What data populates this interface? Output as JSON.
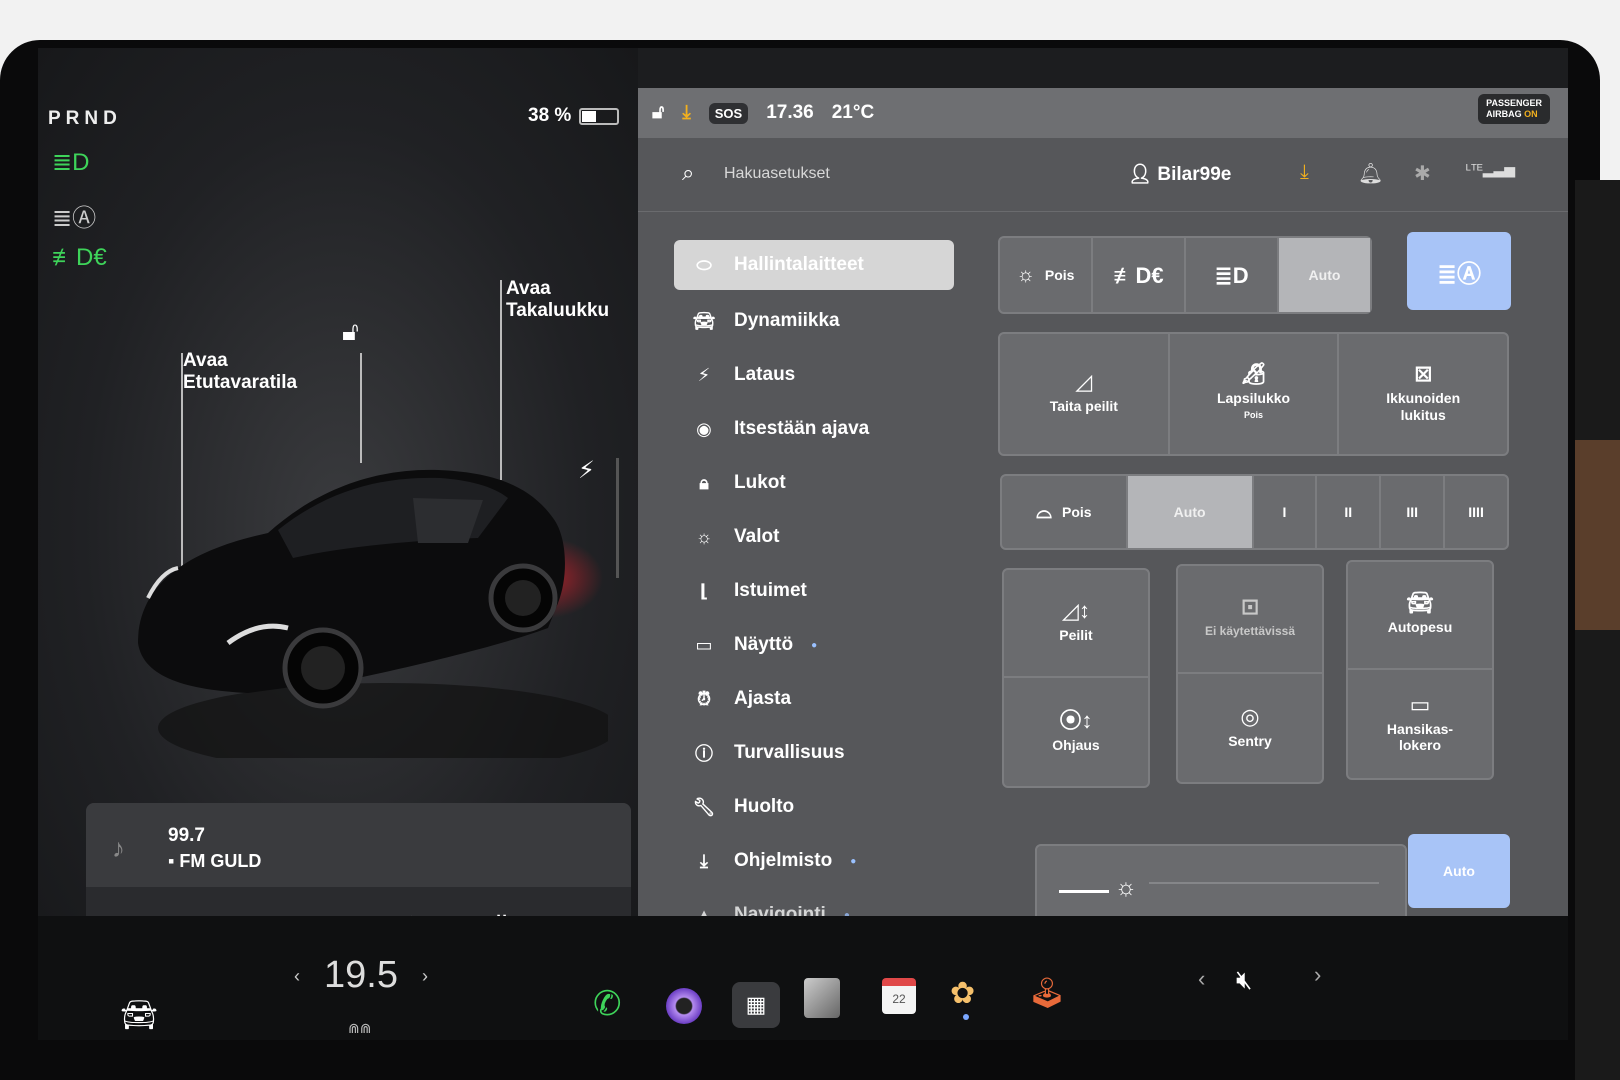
{
  "left": {
    "prnd": "PRND",
    "battery_text": "38 %",
    "battery_level": 0.38,
    "front_trunk": {
      "line1": "Avaa",
      "line2": "Etutavaratila"
    },
    "rear_trunk": {
      "line1": "Avaa",
      "line2": "Takaluukku"
    }
  },
  "media": {
    "frequency": "99.7",
    "station": "FM GULD"
  },
  "status": {
    "sos": "SOS",
    "time": "17.36",
    "temperature": "21°C",
    "airbag_line1": "PASSENGER",
    "airbag_line2": "AIRBAG",
    "airbag_state": "ON"
  },
  "search": {
    "placeholder": "Hakuasetukset",
    "user": "Bilar99e"
  },
  "menu": {
    "items": [
      {
        "label": "Hallintalaitteet"
      },
      {
        "label": "Dynamiikka"
      },
      {
        "label": "Lataus"
      },
      {
        "label": "Itsestään ajava"
      },
      {
        "label": "Lukot"
      },
      {
        "label": "Valot"
      },
      {
        "label": "Istuimet"
      },
      {
        "label": "Näyttö"
      },
      {
        "label": "Ajasta"
      },
      {
        "label": "Turvallisuus"
      },
      {
        "label": "Huolto"
      },
      {
        "label": "Ohjelmisto"
      },
      {
        "label": "Navigointi"
      }
    ]
  },
  "lights": {
    "off": "Pois",
    "auto": "Auto"
  },
  "quick": {
    "fold_mirrors": "Taita peilit",
    "child_lock": "Lapsilukko",
    "child_lock_state": "Pois",
    "window_lock_1": "Ikkunoiden",
    "window_lock_2": "lukitus"
  },
  "wipers": {
    "off": "Pois",
    "auto": "Auto",
    "l1": "I",
    "l2": "II",
    "l3": "III",
    "l4": "IIII"
  },
  "tiles": {
    "mirrors": "Peilit",
    "unavailable": "Ei käytettävissä",
    "carwash": "Autopesu",
    "steering": "Ohjaus",
    "sentry": "Sentry",
    "glovebox_1": "Hansikas-",
    "glovebox_2": "lokero"
  },
  "brightness": {
    "auto": "Auto"
  },
  "dock": {
    "temperature": "19.5",
    "calendar_day": "22"
  }
}
